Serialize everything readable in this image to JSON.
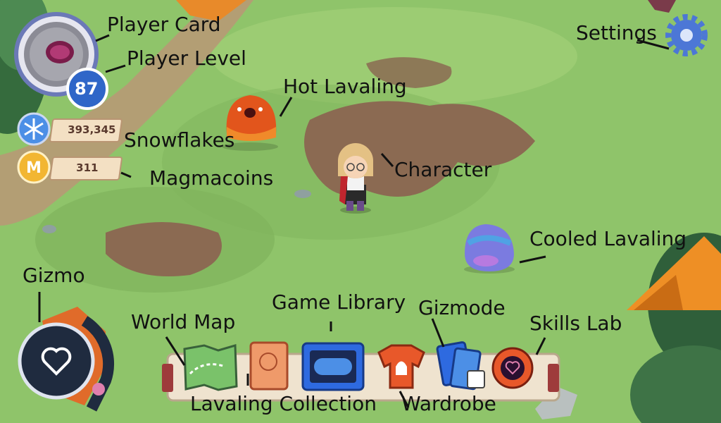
{
  "hud": {
    "player_level": "87",
    "snowflakes": "393,345",
    "magmacoins": "311"
  },
  "labels": {
    "player_card": "Player Card",
    "player_level": "Player Level",
    "hot_lavaling": "Hot Lavaling",
    "snowflakes": "Snowflakes",
    "magmacoins": "Magmacoins",
    "character": "Character",
    "settings": "Settings",
    "cooled_lavaling": "Cooled Lavaling",
    "gizmo": "Gizmo",
    "game_library": "Game Library",
    "gizmode": "Gizmode",
    "world_map": "World Map",
    "skills_lab": "Skills Lab",
    "lavaling_collection": "Lavaling Collection",
    "wardrobe": "Wardrobe"
  },
  "toolbar_items": [
    {
      "icon": "world-map-icon"
    },
    {
      "icon": "lavaling-collection-icon"
    },
    {
      "icon": "game-library-icon"
    },
    {
      "icon": "wardrobe-icon"
    },
    {
      "icon": "gizmode-icon"
    },
    {
      "icon": "skills-lab-icon"
    }
  ],
  "colors": {
    "grass": "#8fc46a",
    "dirt": "#8b6a52",
    "hot_lavaling": "#e2551c",
    "cooled_lavaling": "#7b7be0",
    "coin": "#f2b632",
    "snowflake": "#4c8fe6",
    "level_badge": "#2f66c8",
    "gizmo_dark": "#1f2b3f"
  }
}
